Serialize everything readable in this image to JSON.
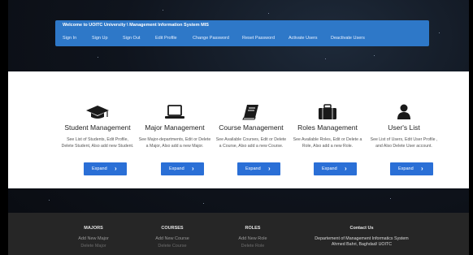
{
  "header": {
    "welcome": "Welcome to UOITC University \\ Management Information System MIS",
    "nav": [
      "Sign In",
      "Sign Up",
      "Sign Out",
      "Edit Profile",
      "Change Password",
      "Reset Password",
      "Activate Users",
      "Deactivate Users"
    ]
  },
  "cards": [
    {
      "icon": "graduation-cap-icon",
      "title": "Student Management",
      "desc": "See List of Students, Edit Profile, Delete Student, Also add new Student.",
      "button": "Expand"
    },
    {
      "icon": "laptop-icon",
      "title": "Major Management",
      "desc": "See Major-departments, Edit or Delete a Major, Also add a new Major.",
      "button": "Expand"
    },
    {
      "icon": "book-icon",
      "title": "Course Management",
      "desc": "See Available Courses, Edit or Delete a Course, Also add a new Course.",
      "button": "Expand"
    },
    {
      "icon": "briefcase-icon",
      "title": "Roles Management",
      "desc": "See Available Roles, Edit or Delete a Role, Also add a new Role.",
      "button": "Expand"
    },
    {
      "icon": "user-icon",
      "title": "User's List",
      "desc": "See List of Users, Edit User Profile , and Also Delete User account.",
      "button": "Expand"
    }
  ],
  "footer": {
    "majors": {
      "heading": "MAJORS",
      "link1": "Add New Major",
      "link2": "Delete Major"
    },
    "courses": {
      "heading": "COURSES",
      "link1": "Add New Course",
      "link2": "Delete Course"
    },
    "roles": {
      "heading": "ROLES",
      "link1": "Add New Role",
      "link2": "Delete Role"
    },
    "contact": {
      "heading": "Contact Us",
      "line1": "Departement of Management Informatics System",
      "line2": "Ahmed Bahri, Baghdad/ UOITC"
    }
  },
  "colors": {
    "accent": "#2a6fd6",
    "header_bar": "#2e78c8",
    "footer_bg": "#262626"
  }
}
